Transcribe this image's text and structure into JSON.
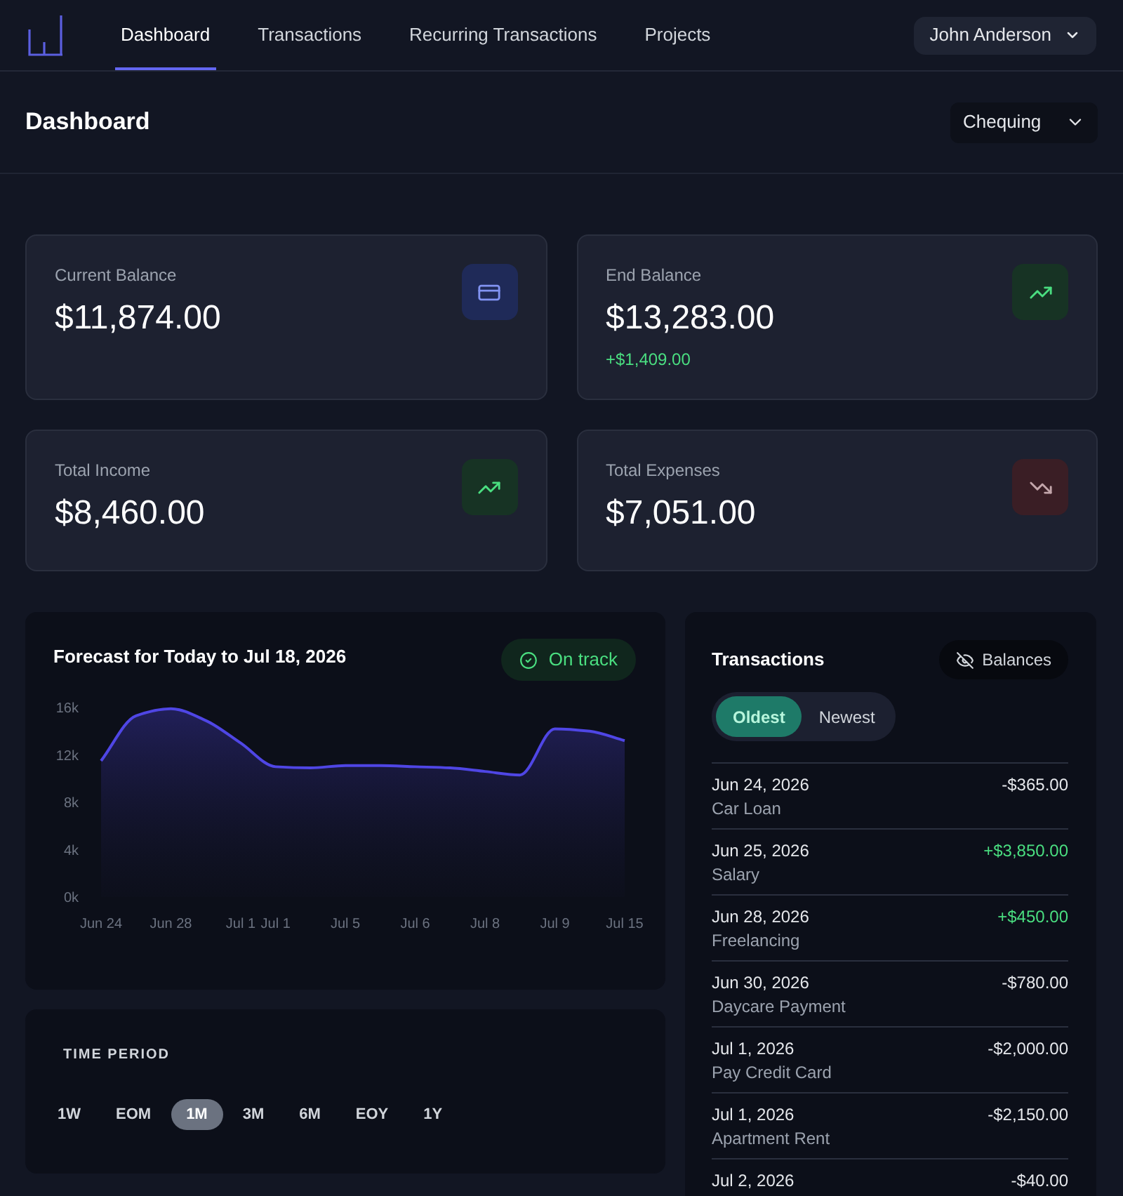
{
  "nav": {
    "tabs": [
      {
        "label": "Dashboard",
        "selected": true
      },
      {
        "label": "Transactions",
        "selected": false
      },
      {
        "label": "Recurring Transactions",
        "selected": false
      },
      {
        "label": "Projects",
        "selected": false
      }
    ],
    "user": "John Anderson"
  },
  "header": {
    "title": "Dashboard",
    "account": "Chequing"
  },
  "summary_cards": [
    {
      "label": "Current Balance",
      "value": "$11,874.00",
      "kind": "card"
    },
    {
      "label": "End Balance",
      "value": "$13,283.00",
      "change": "+$1,409.00",
      "kind": "up"
    },
    {
      "label": "Total Income",
      "value": "$8,460.00",
      "kind": "up"
    },
    {
      "label": "Total Expenses",
      "value": "$7,051.00",
      "kind": "down"
    }
  ],
  "forecast": {
    "status": "On track",
    "chart_data": {
      "type": "area",
      "title": "Forecast for Today to Jul 18, 2026",
      "categories": [
        "Jun 24",
        null,
        "Jun 28",
        null,
        "Jul 1",
        "Jul 1",
        null,
        "Jul 5",
        null,
        "Jul 6",
        null,
        "Jul 8",
        null,
        "Jul 9",
        null,
        "Jul 15"
      ],
      "values": [
        11500,
        15300,
        15900,
        14900,
        13000,
        11000,
        10900,
        11100,
        11100,
        11000,
        10900,
        10600,
        10300,
        14200,
        14000,
        13200
      ],
      "ylim": [
        0,
        16000
      ],
      "yticks": [
        {
          "value": 0,
          "label": "0k"
        },
        {
          "value": 4000,
          "label": "4k"
        },
        {
          "value": 8000,
          "label": "8k"
        },
        {
          "value": 12000,
          "label": "12k"
        },
        {
          "value": 16000,
          "label": "16k"
        }
      ]
    }
  },
  "time_period": {
    "title": "TIME PERIOD",
    "options": [
      {
        "label": "1W",
        "selected": false
      },
      {
        "label": "EOM",
        "selected": false
      },
      {
        "label": "1M",
        "selected": true
      },
      {
        "label": "3M",
        "selected": false
      },
      {
        "label": "6M",
        "selected": false
      },
      {
        "label": "EOY",
        "selected": false
      },
      {
        "label": "1Y",
        "selected": false
      }
    ]
  },
  "transactions": {
    "title": "Transactions",
    "balances_toggle": {
      "label": "Balances",
      "on": false
    },
    "sort": [
      {
        "label": "Oldest",
        "selected": true
      },
      {
        "label": "Newest",
        "selected": false
      }
    ],
    "rows": [
      {
        "date": "Jun 24, 2026",
        "description": "Car Loan",
        "amount": "-$365.00",
        "kind": "expense"
      },
      {
        "date": "Jun 25, 2026",
        "description": "Salary",
        "amount": "+$3,850.00",
        "kind": "income"
      },
      {
        "date": "Jun 28, 2026",
        "description": "Freelancing",
        "amount": "+$450.00",
        "kind": "income"
      },
      {
        "date": "Jun 30, 2026",
        "description": "Daycare Payment",
        "amount": "-$780.00",
        "kind": "expense"
      },
      {
        "date": "Jul 1, 2026",
        "description": "Pay Credit Card",
        "amount": "-$2,000.00",
        "kind": "expense"
      },
      {
        "date": "Jul 1, 2026",
        "description": "Apartment Rent",
        "amount": "-$2,150.00",
        "kind": "expense"
      },
      {
        "date": "Jul 2, 2026",
        "amount": "-$40.00",
        "kind": "expense"
      }
    ]
  }
}
